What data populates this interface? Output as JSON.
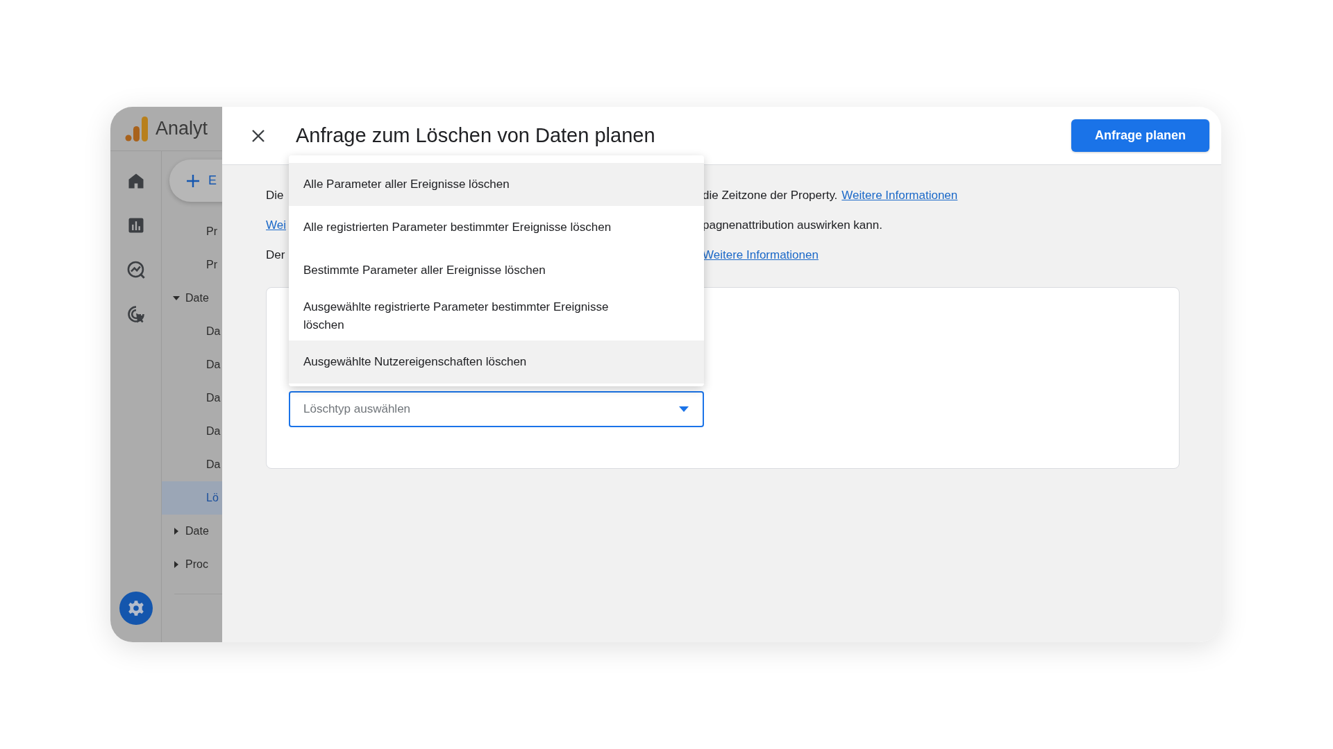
{
  "sidebar": {
    "product_name": "Analyt",
    "create_button": {
      "label": "E"
    },
    "nav_items": [
      {
        "label": "Pr",
        "selected": false
      },
      {
        "label": "Pr",
        "selected": false
      },
      {
        "label": "Date",
        "expanded": true,
        "children": [
          {
            "label": "Da",
            "selected": false
          },
          {
            "label": "Da",
            "selected": false
          },
          {
            "label": "Da",
            "selected": false
          },
          {
            "label": "Da",
            "selected": false
          },
          {
            "label": "Da",
            "selected": false
          },
          {
            "label": "Lö",
            "selected": true
          }
        ]
      },
      {
        "label": "Date",
        "expanded": false
      },
      {
        "label": "Proc",
        "expanded": false
      }
    ]
  },
  "dialog": {
    "title": "Anfrage zum Löschen von Daten planen",
    "primary_button": "Anfrage planen",
    "notice_lines": [
      {
        "left": [
          {
            "kind": "text",
            "text": "Die"
          }
        ],
        "right": [
          {
            "kind": "text",
            "text": "die Zeitzone der Property."
          },
          {
            "kind": "link",
            "text": "Weitere Informationen"
          }
        ]
      },
      {
        "left": [
          {
            "kind": "link",
            "text": "Wei"
          }
        ],
        "right": [
          {
            "kind": "text",
            "text": "pagnenattribution auswirken kann."
          }
        ]
      },
      {
        "left": [
          {
            "kind": "text",
            "text": "Der"
          }
        ],
        "right": [
          {
            "kind": "link",
            "text": "Weitere Informationen"
          }
        ]
      }
    ],
    "select": {
      "placeholder": "Löschtyp auswählen"
    },
    "menu": {
      "items": [
        {
          "label": "Alle Parameter aller Ereignisse löschen",
          "highlighted": true
        },
        {
          "label": "Alle registrierten Parameter bestimmter Ereignisse löschen",
          "highlighted": false
        },
        {
          "label": "Bestimmte Parameter aller Ereignisse löschen",
          "highlighted": false
        },
        {
          "label": "Ausgewählte registrierte Parameter bestimmter Ereignisse löschen",
          "highlighted": false
        },
        {
          "label": "Ausgewählte Nutzereigenschaften löschen",
          "highlighted": true
        }
      ]
    }
  }
}
